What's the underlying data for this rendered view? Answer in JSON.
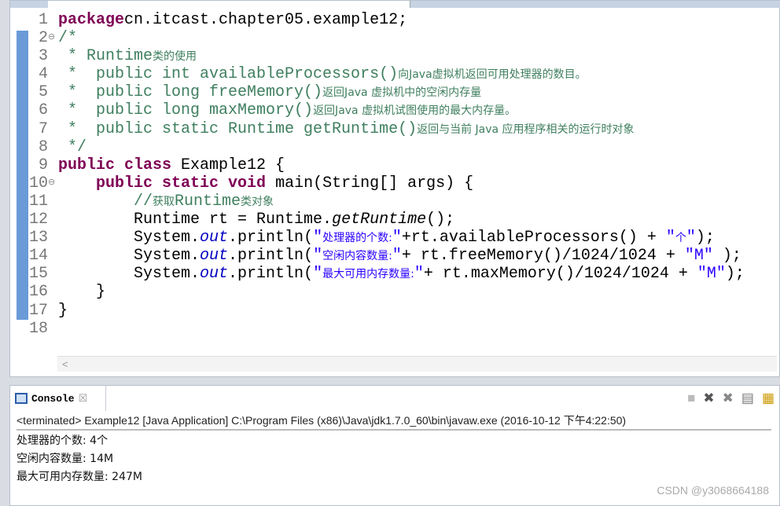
{
  "editor": {
    "highlighted_line": 9,
    "lines": [
      {
        "n": "1",
        "segs": [
          [
            "kw",
            "package"
          ],
          [
            "",
            "cn.itcast.chapter05.example12;"
          ]
        ]
      },
      {
        "n": "2",
        "fold": "⊖",
        "segs": [
          [
            "cm",
            "/*"
          ]
        ]
      },
      {
        "n": "3",
        "segs": [
          [
            "cm",
            " * Runtime"
          ],
          [
            "cm cjk",
            "类的使用"
          ]
        ]
      },
      {
        "n": "4",
        "segs": [
          [
            "cm",
            " *  public int availableProcessors()"
          ],
          [
            "cm cjk",
            "向Java虚拟机返回可用处理器的数目。"
          ]
        ]
      },
      {
        "n": "5",
        "segs": [
          [
            "cm",
            " *  public long freeMemory()"
          ],
          [
            "cm cjk",
            "返回Java 虚拟机中的空闲内存量"
          ]
        ]
      },
      {
        "n": "6",
        "segs": [
          [
            "cm",
            " *  public long maxMemory()"
          ],
          [
            "cm cjk",
            "返回Java 虚拟机试图使用的最大内存量。"
          ]
        ]
      },
      {
        "n": "7",
        "segs": [
          [
            "cm",
            " *  public static Runtime getRuntime()"
          ],
          [
            "cm cjk",
            "返回与当前 Java 应用程序相关的运行时对象"
          ]
        ]
      },
      {
        "n": "8",
        "segs": [
          [
            "cm",
            " */"
          ]
        ]
      },
      {
        "n": "9",
        "segs": [
          [
            "kw",
            "public class"
          ],
          [
            "",
            " Example12 {"
          ]
        ]
      },
      {
        "n": "10",
        "fold": "⊖",
        "segs": [
          [
            "",
            "    "
          ],
          [
            "kw",
            "public static void"
          ],
          [
            "",
            " main(String[] args) {"
          ]
        ]
      },
      {
        "n": "11",
        "segs": [
          [
            "cm",
            "        //"
          ],
          [
            "cm cjk",
            "获取"
          ],
          [
            "cm",
            "Runtime"
          ],
          [
            "cm cjk",
            "类对象"
          ]
        ]
      },
      {
        "n": "12",
        "segs": [
          [
            "",
            "        Runtime rt = Runtime."
          ],
          [
            "it",
            "getRuntime"
          ],
          [
            "",
            "();"
          ]
        ]
      },
      {
        "n": "13",
        "segs": [
          [
            "",
            "        System."
          ],
          [
            "fd",
            "out"
          ],
          [
            "",
            ".println("
          ],
          [
            "st",
            "\""
          ],
          [
            "st cjk",
            "处理器的个数:"
          ],
          [
            "st",
            "\""
          ],
          [
            "",
            "+rt.availableProcessors() + "
          ],
          [
            "st",
            "\""
          ],
          [
            "st cjk",
            "个"
          ],
          [
            "st",
            "\""
          ],
          [
            "",
            ");"
          ]
        ]
      },
      {
        "n": "14",
        "segs": [
          [
            "",
            "        System."
          ],
          [
            "fd",
            "out"
          ],
          [
            "",
            ".println("
          ],
          [
            "st",
            "\""
          ],
          [
            "st cjk",
            "空闲内容数量:"
          ],
          [
            "st",
            "\""
          ],
          [
            "",
            "+ rt.freeMemory()/1024/1024 + "
          ],
          [
            "st",
            "\"M\""
          ],
          [
            "",
            " );"
          ]
        ]
      },
      {
        "n": "15",
        "segs": [
          [
            "",
            "        System."
          ],
          [
            "fd",
            "out"
          ],
          [
            "",
            ".println("
          ],
          [
            "st",
            "\""
          ],
          [
            "st cjk",
            "最大可用内存数量:"
          ],
          [
            "st",
            "\""
          ],
          [
            "",
            "+ rt.maxMemory()/1024/1024 + "
          ],
          [
            "st",
            "\"M\""
          ],
          [
            "",
            ");"
          ]
        ]
      },
      {
        "n": "16",
        "segs": [
          [
            "",
            "    }"
          ]
        ]
      },
      {
        "n": "17",
        "segs": [
          [
            "",
            "}"
          ]
        ]
      },
      {
        "n": "18",
        "segs": []
      }
    ]
  },
  "scroll_left": "<",
  "console": {
    "tab_label": "Console",
    "close": "☒",
    "tools": [
      "■",
      "✖",
      "✖",
      "▤",
      "▦"
    ],
    "header": "<terminated> Example12 [Java Application] C:\\Program Files (x86)\\Java\\jdk1.7.0_60\\bin\\javaw.exe (2016-10-12 下午4:22:50)",
    "output": [
      "处理器的个数: 4个",
      "空闲内容数量: 14M",
      "最大可用内存数量: 247M"
    ]
  },
  "watermark": "CSDN @y3068664188"
}
